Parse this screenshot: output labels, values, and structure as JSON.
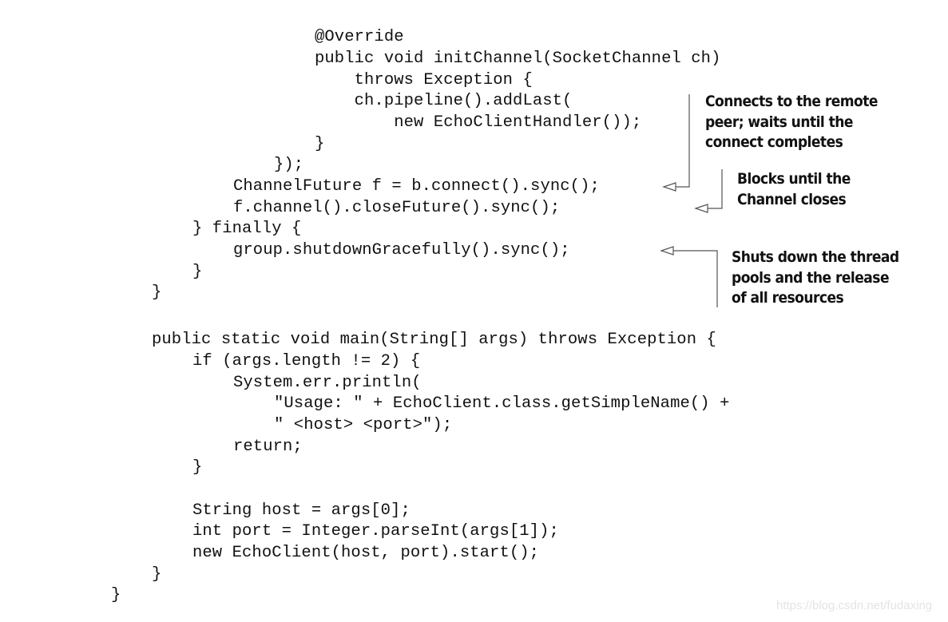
{
  "code_lines": [
    "@Override",
    "public void initChannel(SocketChannel ch)",
    "    throws Exception {",
    "    ch.pipeline().addLast(",
    "        new EchoClientHandler());",
    "}",
    "});",
    "ChannelFuture f = b.connect().sync();",
    "f.channel().closeFuture().sync();",
    "} finally {",
    "group.shutdownGracefully().sync();",
    "}",
    "}",
    "public static void main(String[] args) throws Exception {",
    "if (args.length != 2) {",
    "System.err.println(",
    "\"Usage: \" + EchoClient.class.getSimpleName() +",
    "\" <host> <port>\");",
    "return;",
    "}",
    "String host = args[0];",
    "int port = Integer.parseInt(args[1]);",
    "new EchoClient(host, port).start();",
    "}",
    "}"
  ],
  "annotations": [
    {
      "lines": [
        "Connects to the remote",
        "peer; waits until the",
        "connect completes"
      ]
    },
    {
      "lines": [
        "Blocks until the",
        "Channel closes"
      ]
    },
    {
      "lines": [
        "Shuts down the thread",
        "pools and the release",
        "of all resources"
      ]
    }
  ],
  "watermark": "https://blog.csdn.net/fudaxing"
}
